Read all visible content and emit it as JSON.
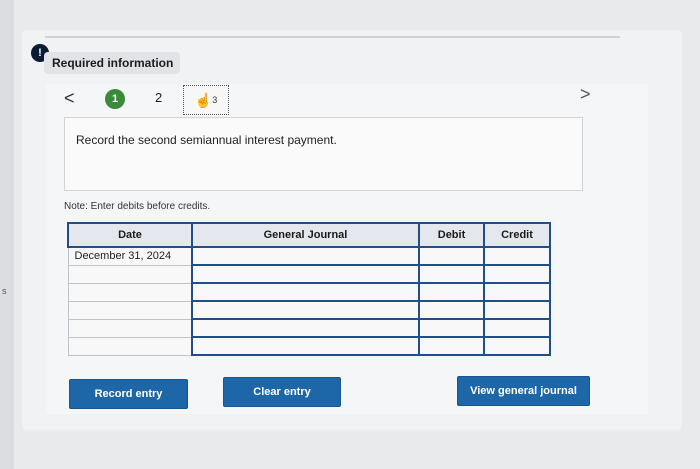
{
  "header": {
    "alert_symbol": "!",
    "required_label": "Required information"
  },
  "nav": {
    "prev": "<",
    "next": ">",
    "steps": [
      "1",
      "2",
      "3"
    ]
  },
  "question": {
    "text": "Record the second semiannual interest payment."
  },
  "note": "Note: Enter debits before credits.",
  "table": {
    "headers": [
      "Date",
      "General Journal",
      "Debit",
      "Credit"
    ],
    "rows": [
      [
        "December 31, 2024",
        "",
        "",
        ""
      ],
      [
        "",
        "",
        "",
        ""
      ],
      [
        "",
        "",
        "",
        ""
      ],
      [
        "",
        "",
        "",
        ""
      ],
      [
        "",
        "",
        "",
        ""
      ],
      [
        "",
        "",
        "",
        ""
      ]
    ]
  },
  "buttons": {
    "record": "Record entry",
    "clear": "Clear entry",
    "view": "View general journal"
  },
  "colors": {
    "accent": "#1d67a8",
    "step_active": "#3a8a3c",
    "table_border": "#1f4f86"
  }
}
